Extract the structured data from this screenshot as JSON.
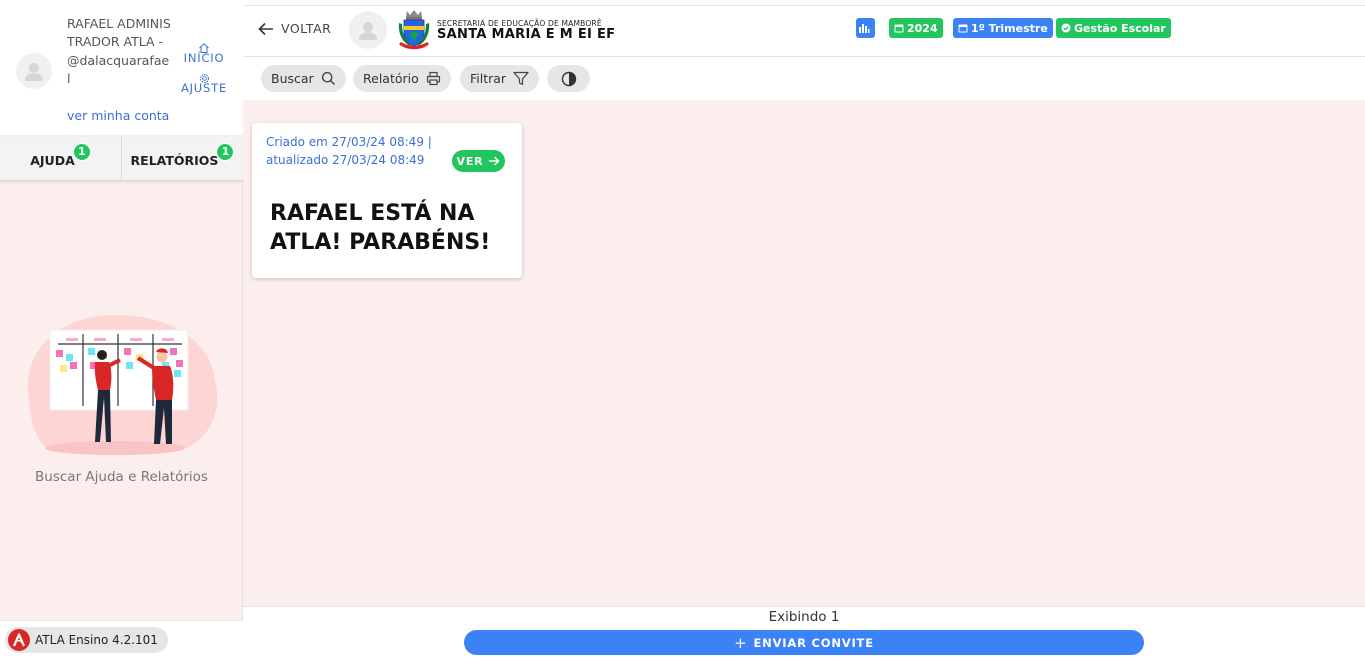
{
  "sidebar": {
    "profile": {
      "name": "RAFAEL ADMINISTRADOR ATLA - @dalacquarafael",
      "my_account_link": "ver minha conta",
      "home_label": "INÍCIO",
      "settings_label": "AJUSTE"
    },
    "tabs": [
      {
        "label": "AJUDA",
        "badge": "1"
      },
      {
        "label": "RELATÓRIOS",
        "badge": "1"
      }
    ],
    "empty_state_text": "Buscar Ajuda e Relatórios",
    "version_label": "ATLA Ensino 4.2.101"
  },
  "header": {
    "back_label": "VOLTAR",
    "secretariat": "SECRETARIA DE EDUCAÇÃO DE MAMBORÊ",
    "school_name": "SANTA MARIA E M EI EF",
    "badges": {
      "year": "2024",
      "term": "1º Trimestre",
      "system": "Gestão Escolar"
    }
  },
  "toolbar": {
    "search_label": "Buscar",
    "report_label": "Relatório",
    "filter_label": "Filtrar"
  },
  "feed": {
    "cards": [
      {
        "dates": "Criado em 27/03/24 08:49 | atualizado 27/03/24 08:49",
        "view_label": "VER",
        "title": "RAFAEL ESTÁ NA ATLA! PARABÉNS!"
      }
    ]
  },
  "footer": {
    "count_text": "Exibindo 1",
    "invite_label": "ENVIAR CONVITE"
  },
  "colors": {
    "accent_blue": "#3b82f6",
    "success_green": "#22c55e",
    "background_pink": "#fdeeee",
    "brand_red": "#d92626"
  }
}
